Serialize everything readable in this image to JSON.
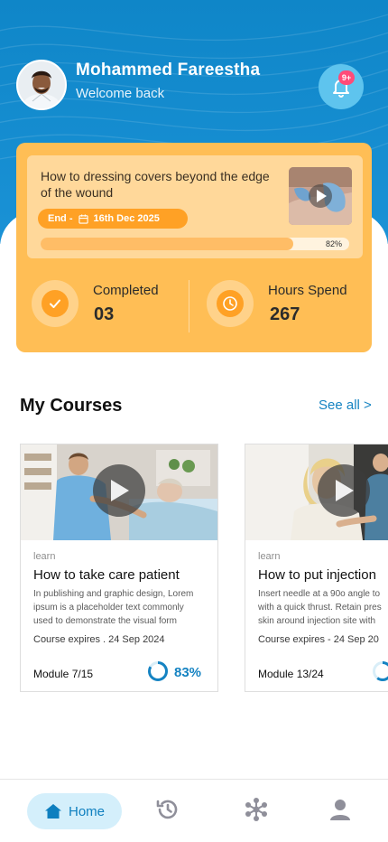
{
  "header": {
    "user_name": "Mohammed Fareestha",
    "welcome": "Welcome back",
    "notification_badge": "9+",
    "colors": {
      "primary": "#1a92d6",
      "accent": "#ffbe55"
    }
  },
  "current_lesson": {
    "title": "How to dressing covers beyond the edge of the wound",
    "end_label": "End -",
    "end_date": "16th Dec 2025",
    "progress_label": "82%",
    "progress_fraction": 0.82
  },
  "stats": [
    {
      "label": "Completed",
      "value": "03",
      "icon": "check-icon"
    },
    {
      "label": "Hours Spend",
      "value": "267",
      "icon": "clock-icon"
    }
  ],
  "section": {
    "title": "My Courses",
    "see_all": "See all >"
  },
  "courses": [
    {
      "category": "learn",
      "title": "How to take care patient",
      "description": [
        "In publishing and graphic design, Lorem",
        "ipsum is a placeholder text commonly",
        "used to demonstrate the visual form"
      ],
      "expires": "Course expires . 24 Sep 2024",
      "module": "Module 7/15",
      "percent": "83%",
      "percent_fraction": 0.83
    },
    {
      "category": "learn",
      "title": "How to put injection",
      "description": [
        "Insert needle at a 90o angle to",
        "with a quick thrust. Retain pres",
        "skin around injection site with"
      ],
      "expires": "Course expires - 24 Sep 20",
      "module": "Module 13/24",
      "percent": "",
      "percent_fraction": 0.6
    }
  ],
  "nav": {
    "home_label": "Home",
    "items": [
      "home-icon",
      "history-icon",
      "network-icon",
      "profile-icon"
    ]
  }
}
